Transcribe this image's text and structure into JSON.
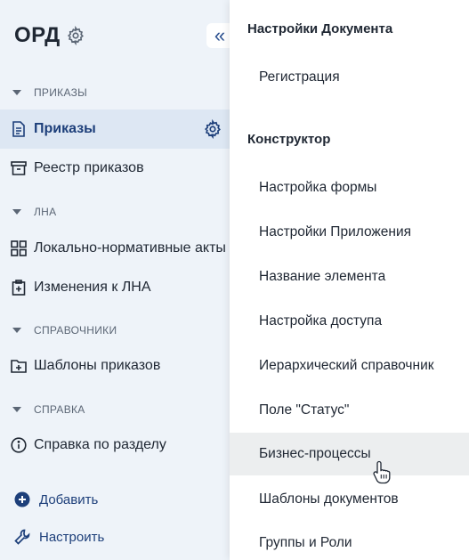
{
  "app": {
    "title": "ОРД"
  },
  "sidebar": {
    "sections": [
      {
        "label": "ПРИКАЗЫ"
      },
      {
        "label": "ЛНА"
      },
      {
        "label": "СПРАВОЧНИКИ"
      },
      {
        "label": "СПРАВКА"
      }
    ],
    "items": [
      {
        "label": "Приказы",
        "icon": "document-icon"
      },
      {
        "label": "Реестр приказов",
        "icon": "archive-box-icon"
      },
      {
        "label": "Локально-нормативные акты",
        "icon": "grid-icon"
      },
      {
        "label": "Изменения к ЛНА",
        "icon": "clipboard-plus-icon"
      },
      {
        "label": "Шаблоны приказов",
        "icon": "folder-plus-icon"
      },
      {
        "label": "Справка по разделу",
        "icon": "info-icon"
      }
    ],
    "bottom": {
      "add_label": "Добавить",
      "configure_label": "Настроить"
    }
  },
  "settings_menu": {
    "doc_heading": "Настройки Документа",
    "doc_items": [
      "Регистрация"
    ],
    "builder_heading": "Конструктор",
    "builder_items": [
      "Настройка формы",
      "Настройки Приложения",
      "Название элемента",
      "Настройка доступа",
      "Иерархический справочник",
      "Поле \"Статус\"",
      "Бизнес-процессы",
      "Шаблоны документов",
      "Группы и Роли"
    ],
    "hovered_item": "Бизнес-процессы"
  },
  "colors": {
    "sidebar_bg": "#eef3f9",
    "active_bg": "#dde7f3",
    "accent": "#1d3f7a",
    "hover_bg": "#eceeef"
  }
}
